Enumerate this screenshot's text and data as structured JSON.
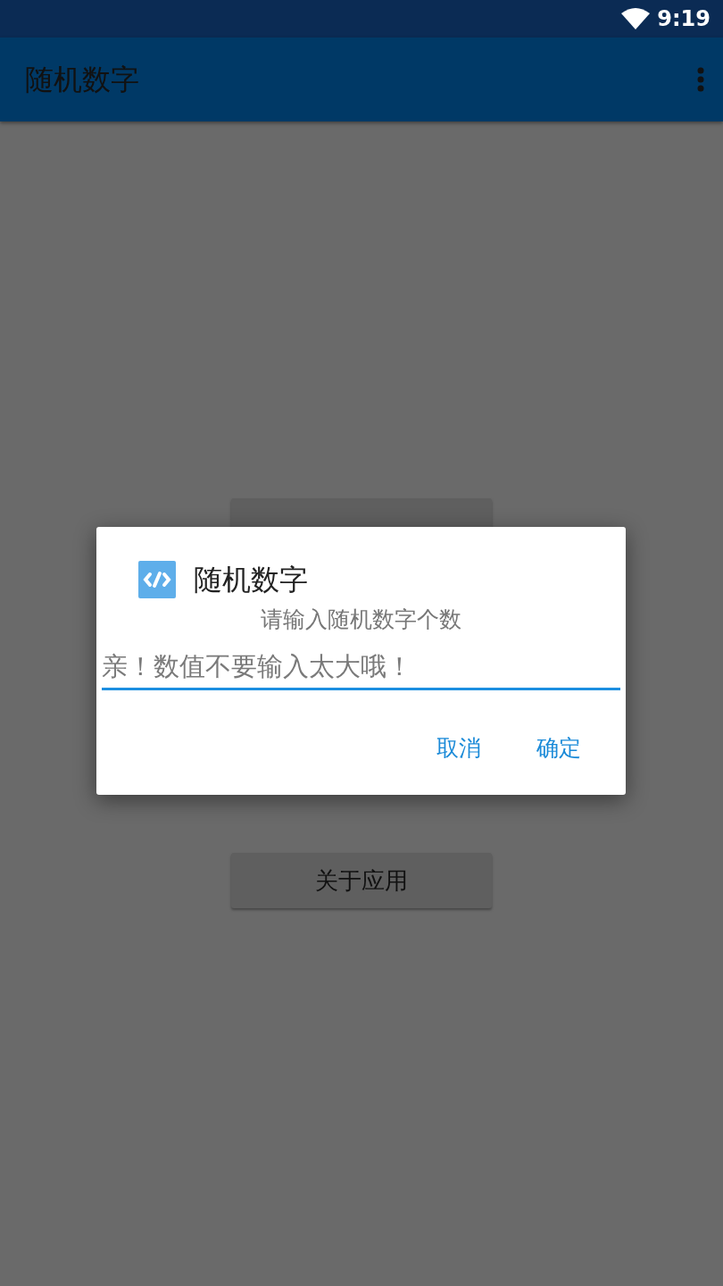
{
  "status_bar": {
    "time": "9:19"
  },
  "app_bar": {
    "title": "随机数字"
  },
  "buttons": [
    {
      "kind": "covered"
    },
    {
      "kind": "plain",
      "label": "关于应用"
    }
  ],
  "dialog": {
    "title": "随机数字",
    "message": "请输入随机数字个数",
    "input": {
      "placeholder": "亲！数值不要输入太大哦！",
      "focused": true
    },
    "actions": [
      {
        "label": "取消"
      },
      {
        "label": "确定"
      }
    ]
  }
}
